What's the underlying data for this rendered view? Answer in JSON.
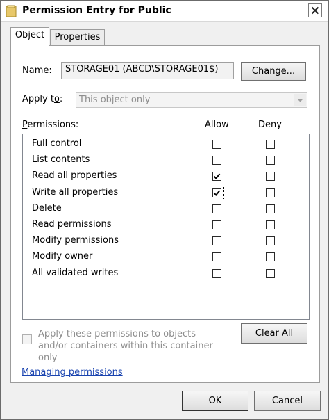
{
  "window": {
    "title": "Permission Entry for Public"
  },
  "tabs": [
    {
      "label": "Object"
    },
    {
      "label": "Properties"
    }
  ],
  "name_row": {
    "label_first": "N",
    "label_rest": "ame:",
    "value": "STORAGE01 (ABCD\\STORAGE01$)",
    "change_button": "Change..."
  },
  "apply_row": {
    "label_pre": "Apply t",
    "label_u": "o",
    "label_post": ":",
    "value": "This object only"
  },
  "permissions": {
    "label_first": "P",
    "label_rest": "ermissions:",
    "allow_header": "Allow",
    "deny_header": "Deny",
    "rows": [
      {
        "name": "Full control",
        "allow": false,
        "deny": false
      },
      {
        "name": "List contents",
        "allow": false,
        "deny": false
      },
      {
        "name": "Read all properties",
        "allow": true,
        "deny": false
      },
      {
        "name": "Write all properties",
        "allow": true,
        "deny": false
      },
      {
        "name": "Delete",
        "allow": false,
        "deny": false
      },
      {
        "name": "Read permissions",
        "allow": false,
        "deny": false
      },
      {
        "name": "Modify permissions",
        "allow": false,
        "deny": false
      },
      {
        "name": "Modify owner",
        "allow": false,
        "deny": false
      },
      {
        "name": "All validated writes",
        "allow": false,
        "deny": false
      }
    ]
  },
  "apply_inherit": {
    "text": "Apply these permissions to objects and/or containers within this container only",
    "checked": false
  },
  "clear_all_button": "Clear All",
  "link": "Managing permissions",
  "footer": {
    "ok": "OK",
    "cancel": "Cancel"
  }
}
